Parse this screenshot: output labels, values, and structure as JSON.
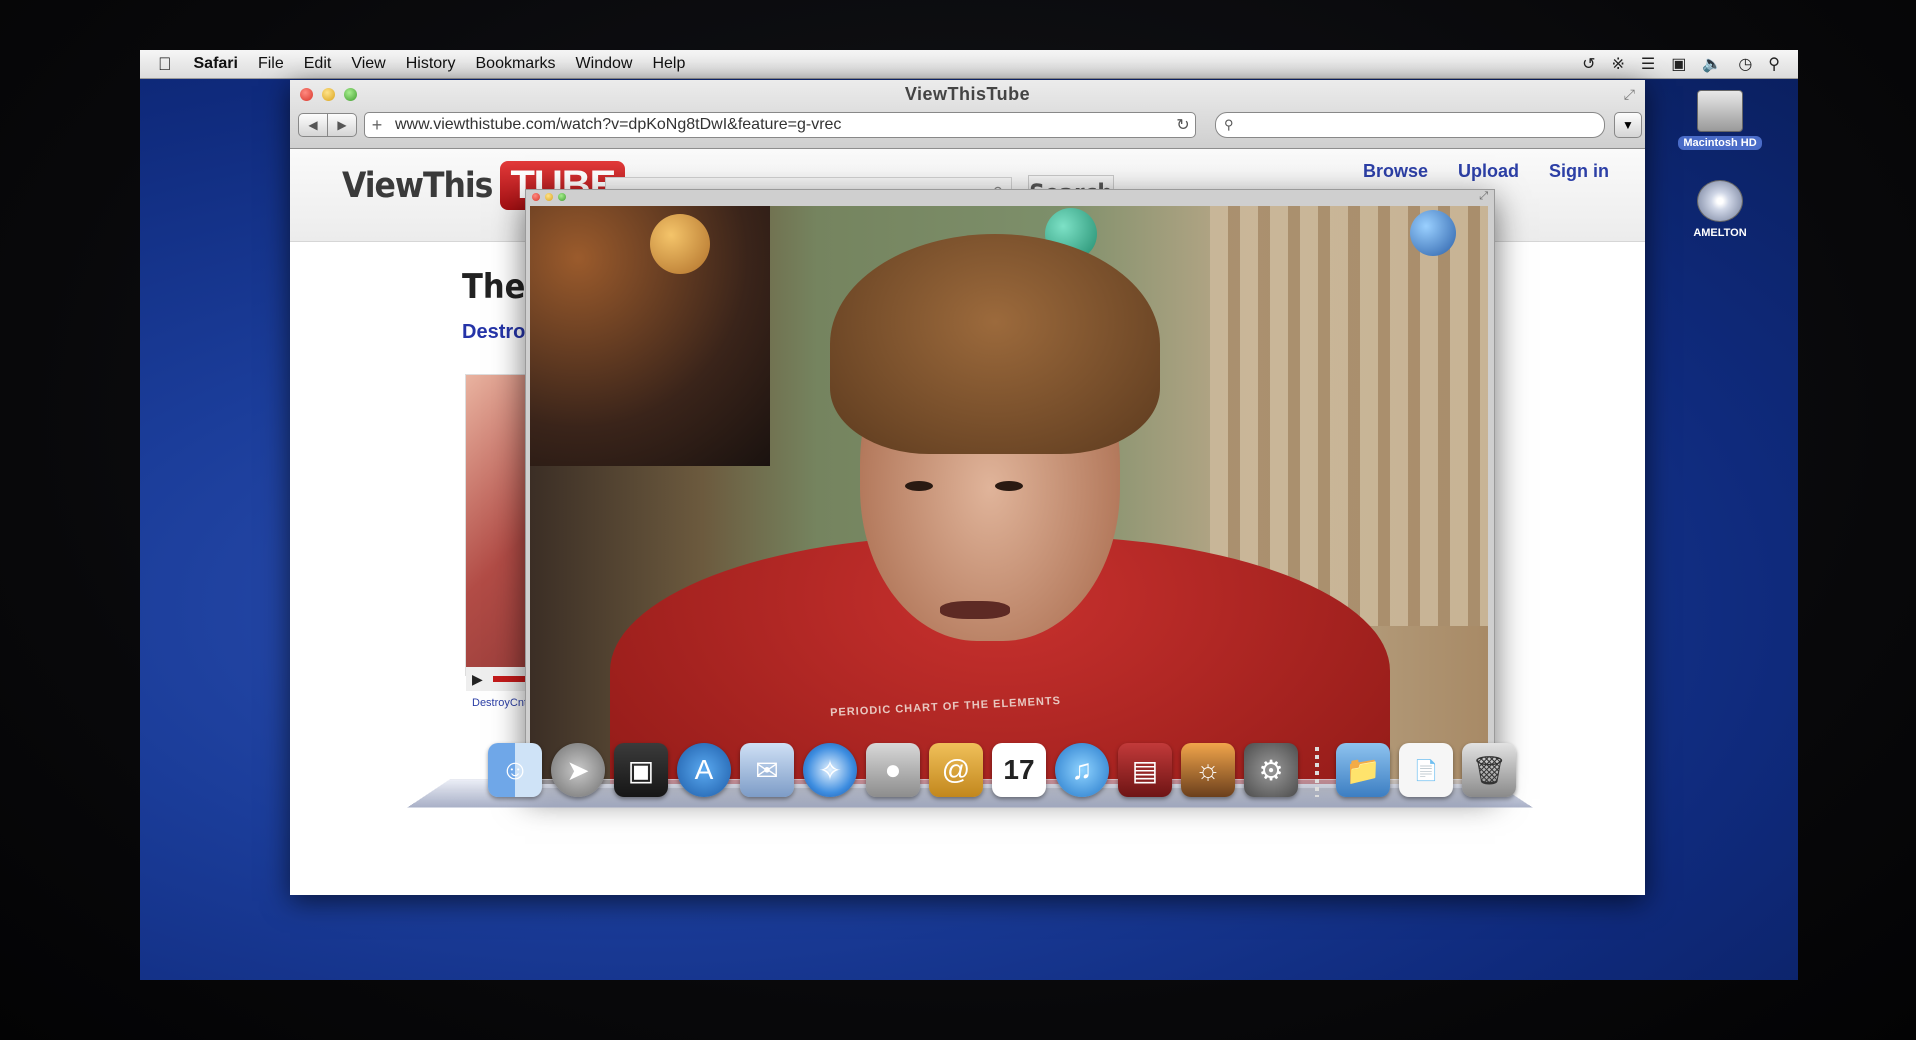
{
  "menubar": {
    "app": "Safari",
    "items": [
      "File",
      "Edit",
      "View",
      "History",
      "Bookmarks",
      "Window",
      "Help"
    ]
  },
  "desktop": {
    "icons": [
      {
        "label": "Macintosh HD",
        "icon": "hard-drive-icon"
      },
      {
        "label": "AMELTON",
        "icon": "disc-icon"
      }
    ]
  },
  "browser": {
    "title": "ViewThisTube",
    "url": "www.viewthistube.com/watch?v=dpKoNg8tDwI&feature=g-vrec",
    "search_placeholder": ""
  },
  "site": {
    "logo_part1": "ViewThis",
    "logo_part2": "TUBE",
    "search_button": "Search",
    "links": [
      "Browse",
      "Upload",
      "Sign in"
    ],
    "video_title_partial": "The",
    "channel_partial": "Destroy",
    "thumb_channel": "DestroyCnt",
    "popup_shirt_text": "PERIODIC CHART OF THE ELEMENTS"
  },
  "dock": {
    "icons": [
      "finder-icon",
      "launchpad-icon",
      "photo-booth-icon",
      "app-store-icon",
      "mail-icon",
      "safari-icon",
      "facetime-icon",
      "address-book-icon",
      "calendar-icon",
      "itunes-icon",
      "photo-browser-icon",
      "iphoto-icon",
      "system-preferences-icon",
      "applications-folder-icon",
      "pages-document-icon",
      "trash-icon"
    ],
    "calendar_date": "17"
  },
  "colors": {
    "link": "#2c3fa6",
    "logo_red": "#c41a1a"
  }
}
